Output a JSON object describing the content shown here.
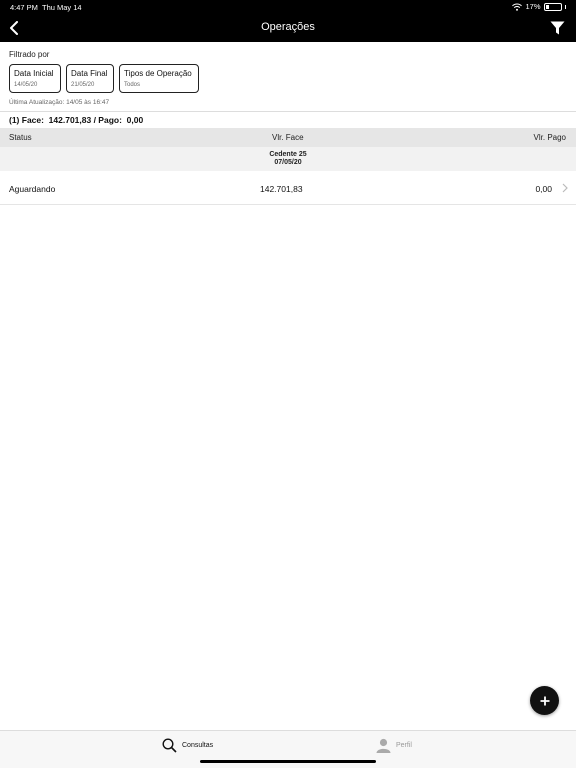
{
  "status_bar": {
    "time": "4:47 PM",
    "date": "Thu May 14",
    "battery": "17%"
  },
  "nav": {
    "title": "Operações"
  },
  "filters": {
    "label": "Filtrado por",
    "chips": [
      {
        "title": "Data Inicial",
        "value": "14/05/20"
      },
      {
        "title": "Data Final",
        "value": "21/05/20"
      },
      {
        "title": "Tipos de Operação",
        "value": "Todos"
      }
    ]
  },
  "last_update": "Última Atualização: 14/05 às 16:47",
  "summary": "(1) Face:  142.701,83 / Pago:  0,00",
  "table": {
    "columns": [
      "Status",
      "Vlr. Face",
      "Vlr. Pago"
    ],
    "group": {
      "name": "Cedente 25",
      "date": "07/05/20"
    },
    "rows": [
      {
        "status": "Aguardando",
        "face": "142.701,83",
        "pago": "0,00"
      }
    ]
  },
  "tabs": [
    {
      "label": "Consultas",
      "icon": "search-icon",
      "active": true
    },
    {
      "label": "Perfil",
      "icon": "person-icon",
      "active": false
    }
  ],
  "colors": {
    "bar": "#000000",
    "header_bg": "#e6e6e6",
    "group_bg": "#f2f2f2",
    "fab": "#111111",
    "inactive": "#999999"
  }
}
